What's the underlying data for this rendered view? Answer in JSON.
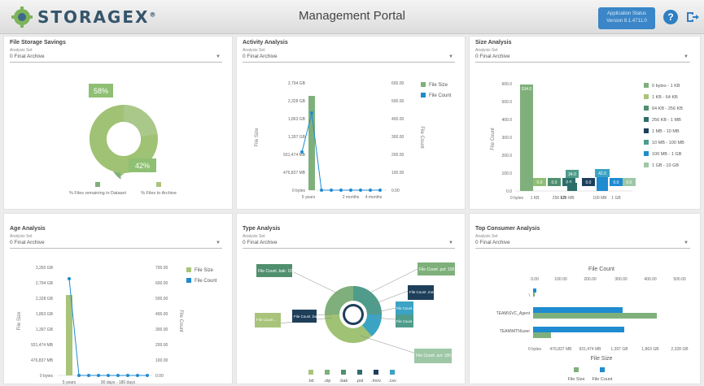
{
  "header": {
    "brand": "STORAGEX",
    "brand_mark": "®",
    "title": "Management Portal",
    "status_line1": "Application Status",
    "status_line2": "Version 8.1.4711.0"
  },
  "panels": {
    "storage_savings": {
      "title": "File Storage Savings",
      "set_label": "Analysis Set",
      "set_value": "0 Final Archive",
      "label_remaining": "58%",
      "label_archive": "42%",
      "legend": [
        "% Files remaining in Dataset",
        "% Files to Archive"
      ]
    },
    "activity": {
      "title": "Activity Analysis",
      "set_label": "Analysis Set",
      "set_value": "0 Final Archive",
      "y_left_label": "File Size",
      "y_right_label": "File Count",
      "y_left_ticks": [
        "2,794 GB",
        "2,328 GB",
        "1,863 GB",
        "1,397 GB",
        "931,474 MB",
        "476,837 MB",
        "0 bytes"
      ],
      "y_right_ticks": [
        "600.00",
        "500.00",
        "400.00",
        "300.00",
        "200.00",
        "100.00",
        "0.00"
      ],
      "x_ticks": [
        "5 years",
        "2 months",
        "4 months"
      ],
      "legend": [
        "File Size",
        "File Count"
      ]
    },
    "size": {
      "title": "Size Analysis",
      "set_label": "Analysis Set",
      "set_value": "0 Final Archive",
      "y_label": "File Count",
      "y_ticks": [
        "600.0",
        "500.0",
        "400.0",
        "300.0",
        "200.0",
        "100.0",
        "0.0"
      ],
      "x_ticks": [
        "0 bytes",
        "1 KB",
        "256 KB",
        "128 MB",
        "100 MB",
        "1 GB"
      ],
      "bar_labels": [
        "534.0",
        "0.0",
        "0.0",
        "0.0",
        "34.0",
        "0.0",
        "42.0",
        "0.0",
        "0.0"
      ],
      "legend": [
        "0 bytes - 1 KB",
        "1 KB - 64 KB",
        "64 KB - 256 KB",
        "256 KB - 1 MB",
        "1 MB - 10 MB",
        "10 MB - 100 MB",
        "100 MB - 1 GB",
        "1 GB - 10 GB"
      ]
    },
    "age": {
      "title": "Age Analysis",
      "set_label": "Analysis Set",
      "set_value": "0 Final Archive",
      "y_left_label": "File Size",
      "y_right_label": "File Count",
      "y_left_ticks": [
        "3,260 GB",
        "2,794 GB",
        "2,328 GB",
        "1,863 GB",
        "1,397 GB",
        "931,474 MB",
        "476,837 MB",
        "0 bytes"
      ],
      "y_right_ticks": [
        "700.00",
        "600.00",
        "500.00",
        "400.00",
        "300.00",
        "200.00",
        "100.00",
        "0.00"
      ],
      "x_ticks": [
        "5 years",
        "90 days - 180 days"
      ],
      "legend": [
        "File Size",
        "File Count"
      ]
    },
    "type": {
      "title": "Type Analysis",
      "set_label": "Analysis Set",
      "set_value": "0 Final Archive",
      "callouts": [
        "File Count .bak: 100.0 ...",
        "File Count .pst: 100.0 ...",
        "File Count .mov ...",
        "File Count .bak ...",
        "File Count .csv ...",
        "File Count .jpg ...",
        "File Count ...",
        "File Count .avi: 100.0 ..."
      ],
      "legend": [
        ".txt",
        ".zip",
        ".bak",
        ".pst",
        ".mov",
        ".csv"
      ]
    },
    "consumer": {
      "title": "Top Consumer Analysis",
      "set_label": "Analysis Set",
      "set_value": "0 Final Archive",
      "x_top_label": "File Count",
      "x_top_ticks": [
        "0.00",
        "100.00",
        "200.00",
        "300.00",
        "400.00",
        "500.00"
      ],
      "x_bottom_label": "File Size",
      "x_bottom_ticks": [
        "0 bytes",
        "476,837 MB",
        "931,474 MB",
        "1,397 GB",
        "1,863 GB",
        "2,328 GB"
      ],
      "categories": [
        "\\",
        "TEAM\\SVC_Agent",
        "TEAM\\MTN\\user"
      ],
      "legend": [
        "File Size",
        "File Count"
      ]
    }
  },
  "colors": {
    "green_light": "#a9c47a",
    "green_mid": "#7fb07b",
    "teal": "#4f9c8c",
    "blue": "#1f8bd0",
    "navy": "#1e3f5a",
    "sage": "#9ec7a5"
  }
}
